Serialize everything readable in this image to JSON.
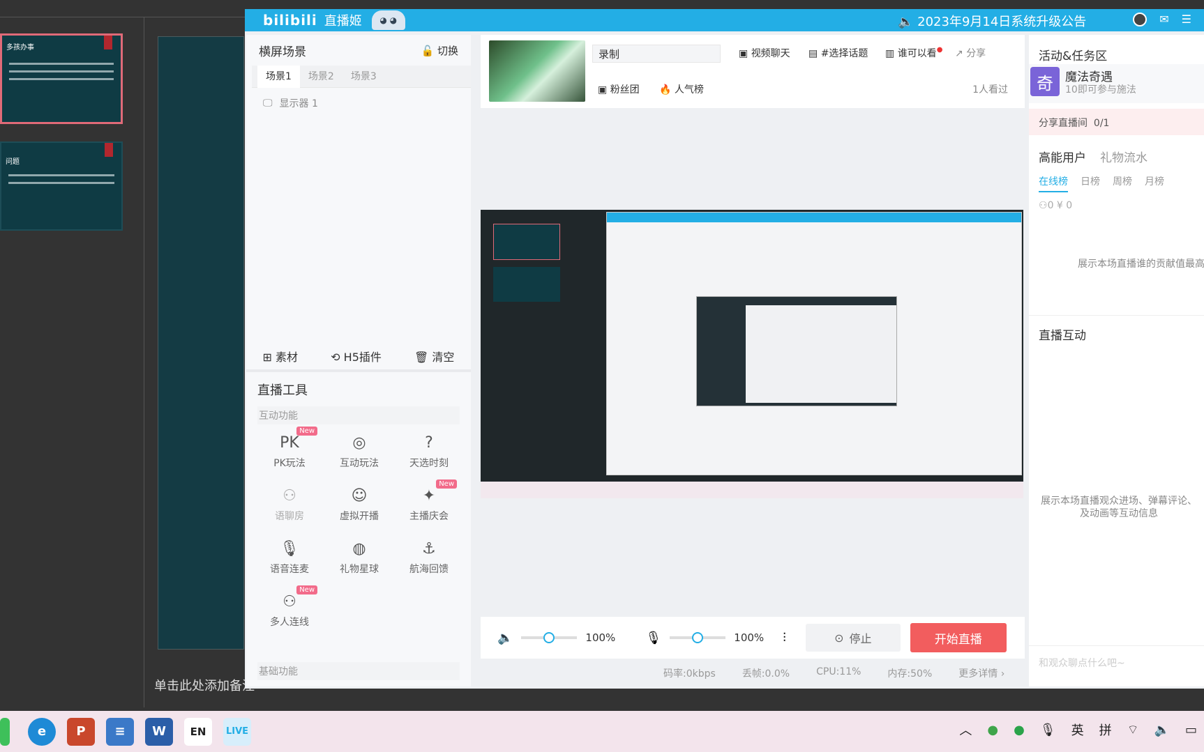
{
  "ppt": {
    "notes_placeholder": "单击此处添加备注",
    "thumb1_title": "多孩办事",
    "thumb2_title": "问题"
  },
  "window": {
    "logo": "bilibili",
    "app_name": "直播姬",
    "announcement": "2023年9月14日系统升级公告",
    "accent": "#23aee5"
  },
  "scene": {
    "header": "横屏场景",
    "switch_label": "切换",
    "tabs": [
      "场景1",
      "场景2",
      "场景3"
    ],
    "source": "显示器 1",
    "actions": {
      "material": "素材",
      "h5": "H5插件",
      "clear": "清空"
    }
  },
  "tools": {
    "title": "直播工具",
    "interact_label": "互动功能",
    "basic_label": "基础功能",
    "items": [
      {
        "label": "PK玩法",
        "icon": "pk-icon",
        "badge": "New"
      },
      {
        "label": "互动玩法",
        "icon": "gamepad-icon",
        "badge": ""
      },
      {
        "label": "天选时刻",
        "icon": "gift-box-icon",
        "badge": ""
      },
      {
        "label": "语聊房",
        "icon": "people-icon",
        "badge": ""
      },
      {
        "label": "虚拟开播",
        "icon": "avatar-icon",
        "badge": ""
      },
      {
        "label": "主播庆会",
        "icon": "party-icon",
        "badge": "New"
      },
      {
        "label": "语音连麦",
        "icon": "mic-user-icon",
        "badge": ""
      },
      {
        "label": "礼物星球",
        "icon": "planet-icon",
        "badge": ""
      },
      {
        "label": "航海回馈",
        "icon": "anchor-icon",
        "badge": ""
      },
      {
        "label": "多人连线",
        "icon": "multi-user-icon",
        "badge": "New"
      }
    ]
  },
  "stream": {
    "title_value": "录制",
    "video_chat": "视频聊天",
    "topic": "#选择话题",
    "visibility": "谁可以看",
    "share": "分享",
    "fans": "粉丝团",
    "popularity": "人气榜",
    "viewers": "1人看过"
  },
  "controls": {
    "speaker_pct": "100%",
    "mic_pct": "100%",
    "speaker_level": 0.5,
    "mic_level": 0.5,
    "stop": "停止",
    "start": "开始直播"
  },
  "status": {
    "bitrate": "码率:0kbps",
    "drop": "丢帧:0.0%",
    "cpu": "CPU:11%",
    "mem": "内存:50%",
    "more": "更多详情"
  },
  "right": {
    "activity_title": "活动&任务区",
    "activity_name": "魔法奇遇",
    "activity_sub": "10即可参与施法",
    "activity_icon": "奇",
    "share_room": "分享直播间",
    "share_count": "0/1",
    "rank_tabs": [
      "高能用户",
      "礼物流水"
    ],
    "rank_periods": [
      "在线榜",
      "日榜",
      "周榜",
      "月榜"
    ],
    "rank_stats": "0 ¥ 0",
    "rank_empty": "展示本场直播谁的贡献值最高",
    "interact_title": "直播互动",
    "interact_empty": "展示本场直播观众进场、弹幕评论、及动画等互动信息",
    "chat_placeholder": "和观众聊点什么吧~"
  },
  "taskbar": {
    "ime_lang": "英",
    "ime_mode": "拼",
    "apps": [
      "wechat-icon",
      "edge-icon",
      "powerpoint-icon",
      "notepad-icon",
      "word-icon",
      "en-icon",
      "live-icon"
    ]
  }
}
